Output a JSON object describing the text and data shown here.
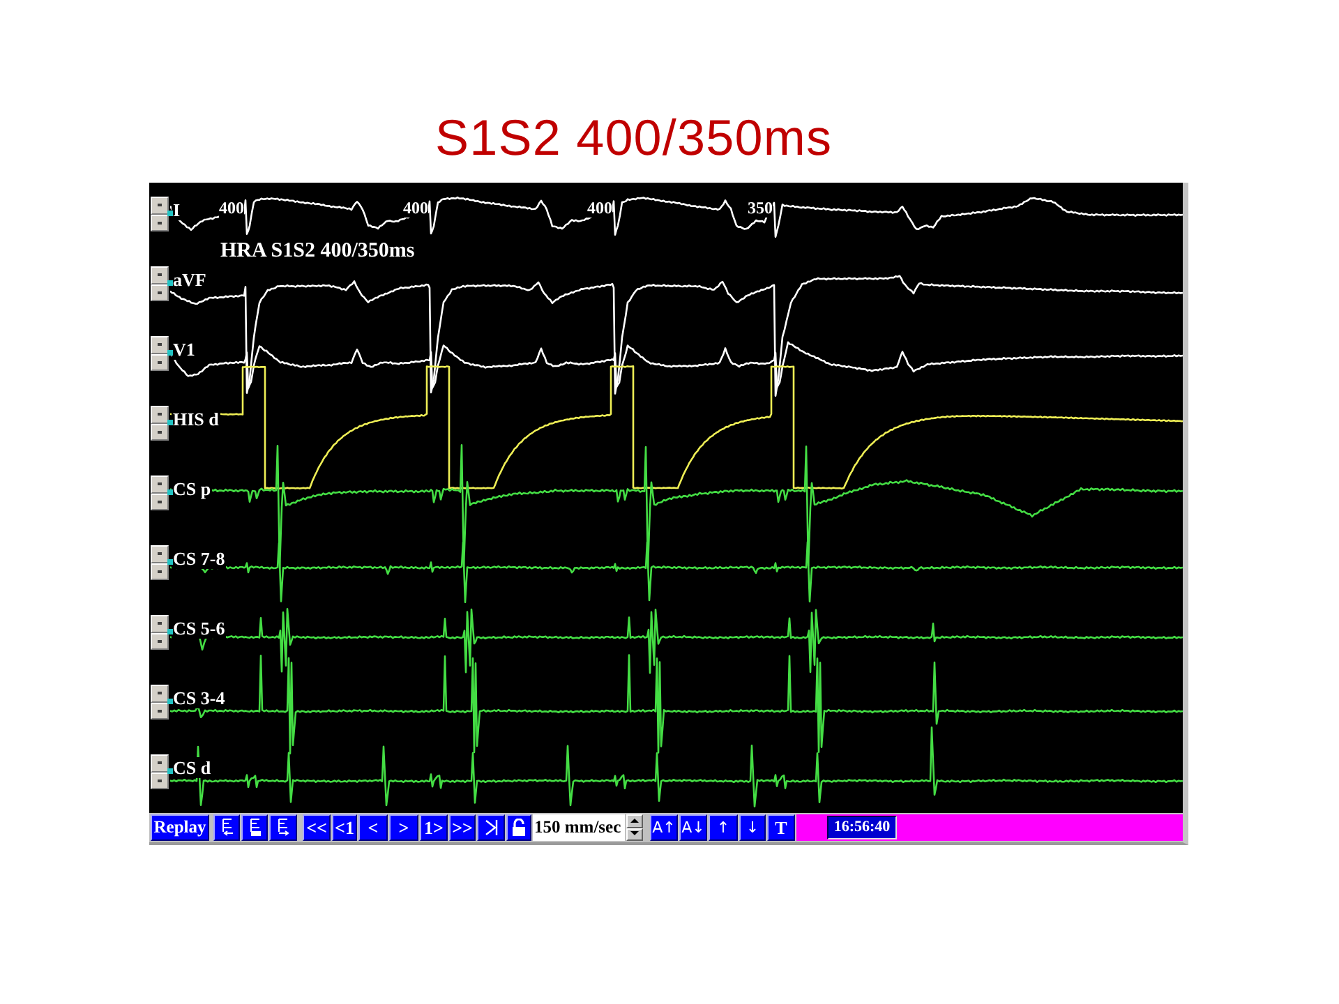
{
  "slide": {
    "title": "S1S2 400/350ms"
  },
  "recording": {
    "channels": [
      {
        "label": "I",
        "color": "#ffffff"
      },
      {
        "label": "aVF",
        "color": "#ffffff"
      },
      {
        "label": "V1",
        "color": "#ffffff"
      },
      {
        "label": "HIS d",
        "color": "#eeee55"
      },
      {
        "label": "CS p",
        "color": "#44dd44"
      },
      {
        "label": "CS 7-8",
        "color": "#44dd44"
      },
      {
        "label": "CS 5-6",
        "color": "#44dd44"
      },
      {
        "label": "CS 3-4",
        "color": "#44dd44"
      },
      {
        "label": "CS d",
        "color": "#44dd44"
      }
    ],
    "interval_labels": [
      "400",
      "400",
      "400",
      "350"
    ],
    "annotation": "HRA S1S2 400/350ms"
  },
  "toolbar": {
    "replay_button": "Replay",
    "nav_buttons": [
      "<<",
      "<1",
      "<",
      ">",
      "1>",
      ">>"
    ],
    "speed_field": {
      "value": "150 mm/sec"
    },
    "buttons": [
      "A↑",
      "A↓",
      "↑",
      "↓",
      "T"
    ],
    "status_bar": {
      "time": "16:56:40"
    }
  }
}
